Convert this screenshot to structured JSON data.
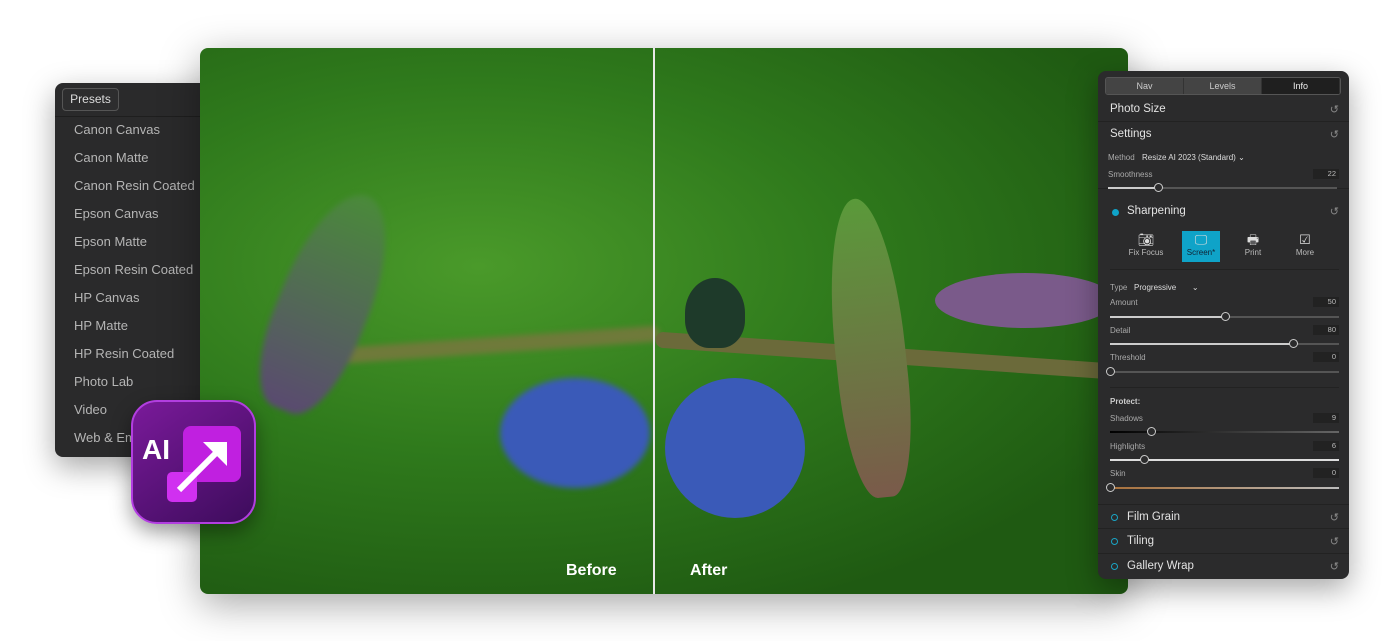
{
  "presets": {
    "button": "Presets",
    "items": [
      "Canon Canvas",
      "Canon Matte",
      "Canon Resin Coated",
      "Epson Canvas",
      "Epson Matte",
      "Epson Resin Coated",
      "HP Canvas",
      "HP Matte",
      "HP Resin Coated",
      "Photo Lab",
      "Video",
      "Web & Email"
    ]
  },
  "photo": {
    "before_label": "Before",
    "after_label": "After"
  },
  "app_icon": {
    "text": "AI",
    "icon": "ai-resize-arrow-icon"
  },
  "panel": {
    "tabs": [
      {
        "label": "Nav"
      },
      {
        "label": "Levels"
      },
      {
        "label": "Info",
        "active": true
      }
    ],
    "photo_size": "Photo Size",
    "settings": {
      "title": "Settings",
      "method_label": "Method",
      "method_value": "Resize AI 2023 (Standard)",
      "smoothness_label": "Smoothness",
      "smoothness": 22
    },
    "sharpening": {
      "title": "Sharpening",
      "modes": [
        {
          "label": "Fix Focus",
          "icon": "camera-icon"
        },
        {
          "label": "Screen*",
          "icon": "monitor-icon",
          "active": true
        },
        {
          "label": "Print",
          "icon": "printer-icon"
        },
        {
          "label": "More",
          "icon": "chevron-box-icon"
        }
      ],
      "type_label": "Type",
      "type_value": "Progressive",
      "amount_label": "Amount",
      "amount": 50,
      "detail_label": "Detail",
      "detail": 80,
      "threshold_label": "Threshold",
      "threshold": 0,
      "protect_label": "Protect:",
      "shadows_label": "Shadows",
      "shadows": 9,
      "highlights_label": "Highlights",
      "highlights": 6,
      "skin_label": "Skin",
      "skin": 0
    },
    "film_grain": "Film Grain",
    "tiling": "Tiling",
    "gallery_wrap": "Gallery Wrap",
    "accent": "#0fa3c8"
  }
}
